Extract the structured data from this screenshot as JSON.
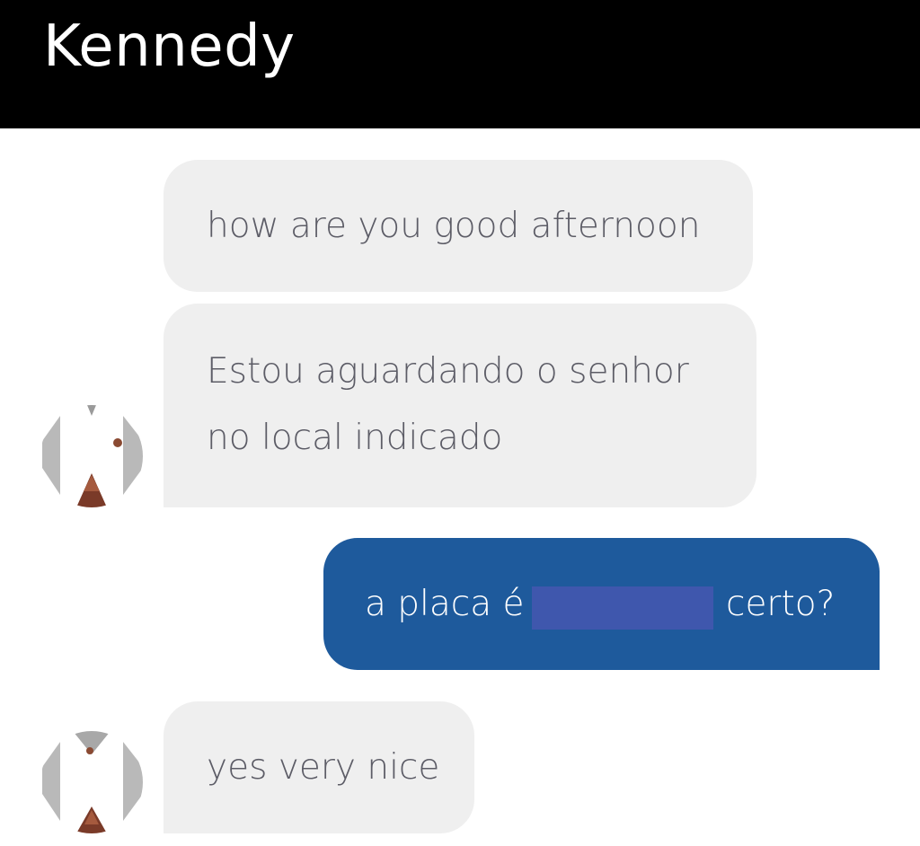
{
  "header": {
    "title": "Kennedy"
  },
  "messages": [
    {
      "direction": "incoming",
      "lines": [
        "how are you good afternoon"
      ]
    },
    {
      "direction": "incoming",
      "lines": [
        "Estou aguardando o senhor",
        "no local indicado"
      ]
    },
    {
      "direction": "outgoing",
      "before_redaction": "a placa é",
      "after_redaction": "certo?",
      "has_redaction": true
    },
    {
      "direction": "incoming",
      "lines": [
        "yes very nice"
      ]
    }
  ],
  "colors": {
    "header_background": "#000000",
    "header_text": "#ffffff",
    "incoming_bubble": "#efefef",
    "incoming_text": "#5c5c66",
    "outgoing_bubble": "#1e5a9c",
    "outgoing_text": "#ffffff",
    "redaction": "#3f57ad"
  },
  "avatars": [
    {
      "icon": "driver-avatar-icon",
      "obscured": true
    },
    {
      "icon": "driver-avatar-icon",
      "obscured": true
    }
  ]
}
